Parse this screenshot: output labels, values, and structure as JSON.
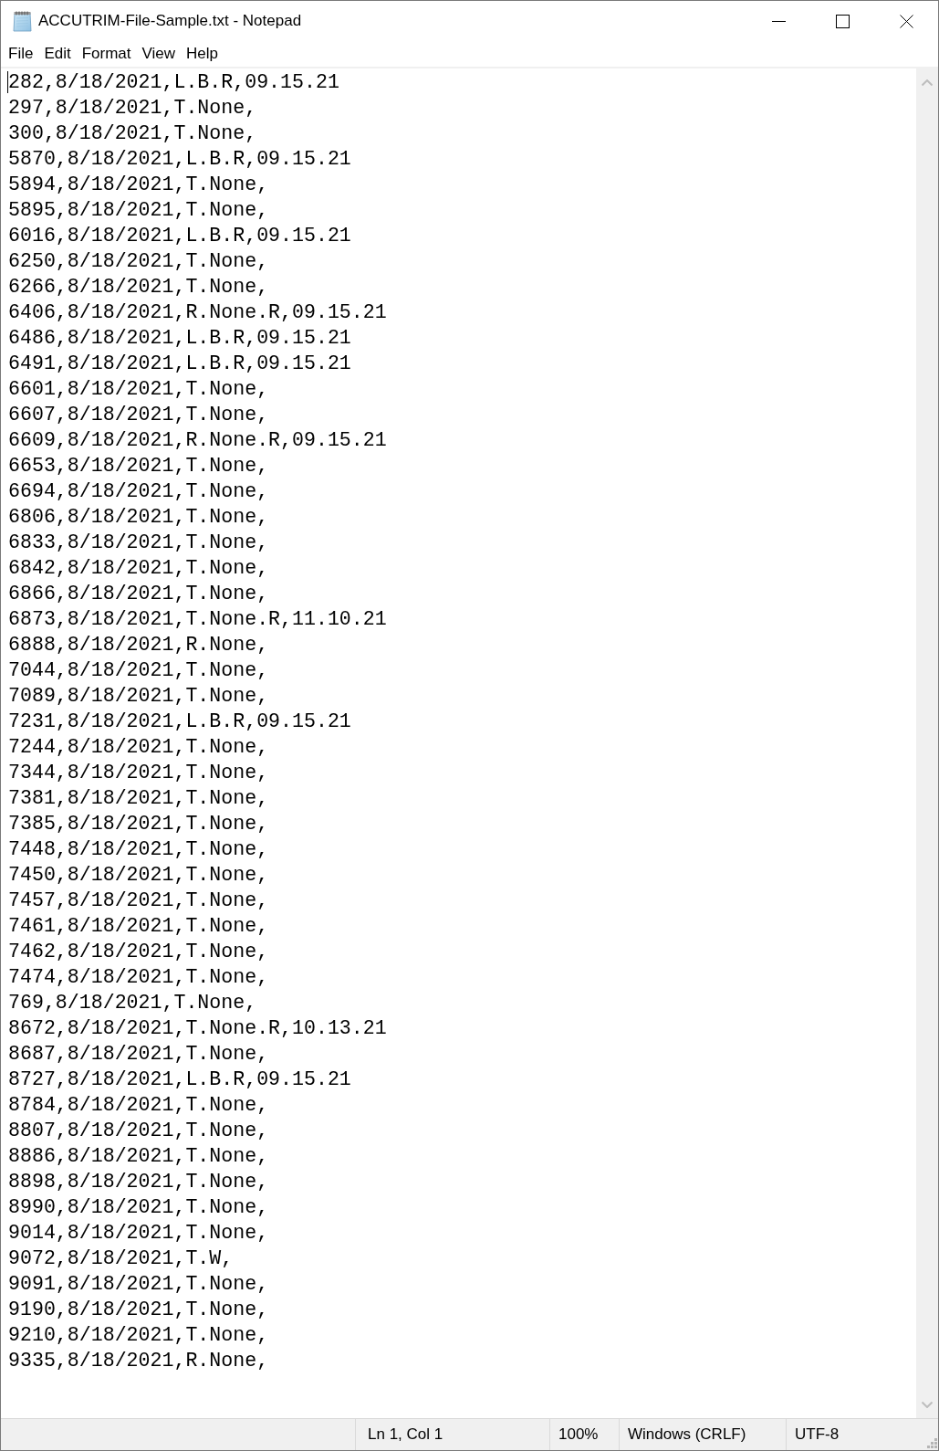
{
  "window": {
    "title": "ACCUTRIM-File-Sample.txt - Notepad"
  },
  "menu_bar": [
    "File",
    "Edit",
    "Format",
    "View",
    "Help"
  ],
  "editor": {
    "caret_visible": true,
    "lines": [
      "282,8/18/2021,L.B.R,09.15.21",
      "297,8/18/2021,T.None,",
      "300,8/18/2021,T.None,",
      "5870,8/18/2021,L.B.R,09.15.21",
      "5894,8/18/2021,T.None,",
      "5895,8/18/2021,T.None,",
      "6016,8/18/2021,L.B.R,09.15.21",
      "6250,8/18/2021,T.None,",
      "6266,8/18/2021,T.None,",
      "6406,8/18/2021,R.None.R,09.15.21",
      "6486,8/18/2021,L.B.R,09.15.21",
      "6491,8/18/2021,L.B.R,09.15.21",
      "6601,8/18/2021,T.None,",
      "6607,8/18/2021,T.None,",
      "6609,8/18/2021,R.None.R,09.15.21",
      "6653,8/18/2021,T.None,",
      "6694,8/18/2021,T.None,",
      "6806,8/18/2021,T.None,",
      "6833,8/18/2021,T.None,",
      "6842,8/18/2021,T.None,",
      "6866,8/18/2021,T.None,",
      "6873,8/18/2021,T.None.R,11.10.21",
      "6888,8/18/2021,R.None,",
      "7044,8/18/2021,T.None,",
      "7089,8/18/2021,T.None,",
      "7231,8/18/2021,L.B.R,09.15.21",
      "7244,8/18/2021,T.None,",
      "7344,8/18/2021,T.None,",
      "7381,8/18/2021,T.None,",
      "7385,8/18/2021,T.None,",
      "7448,8/18/2021,T.None,",
      "7450,8/18/2021,T.None,",
      "7457,8/18/2021,T.None,",
      "7461,8/18/2021,T.None,",
      "7462,8/18/2021,T.None,",
      "7474,8/18/2021,T.None,",
      "769,8/18/2021,T.None,",
      "8672,8/18/2021,T.None.R,10.13.21",
      "8687,8/18/2021,T.None,",
      "8727,8/18/2021,L.B.R,09.15.21",
      "8784,8/18/2021,T.None,",
      "8807,8/18/2021,T.None,",
      "8886,8/18/2021,T.None,",
      "8898,8/18/2021,T.None,",
      "8990,8/18/2021,T.None,",
      "9014,8/18/2021,T.None,",
      "9072,8/18/2021,T.W,",
      "9091,8/18/2021,T.None,",
      "9190,8/18/2021,T.None,",
      "9210,8/18/2021,T.None,",
      "9335,8/18/2021,R.None,"
    ]
  },
  "status_bar": {
    "position": "Ln 1, Col 1",
    "zoom": "100%",
    "line_ending": "Windows (CRLF)",
    "encoding": "UTF-8"
  }
}
